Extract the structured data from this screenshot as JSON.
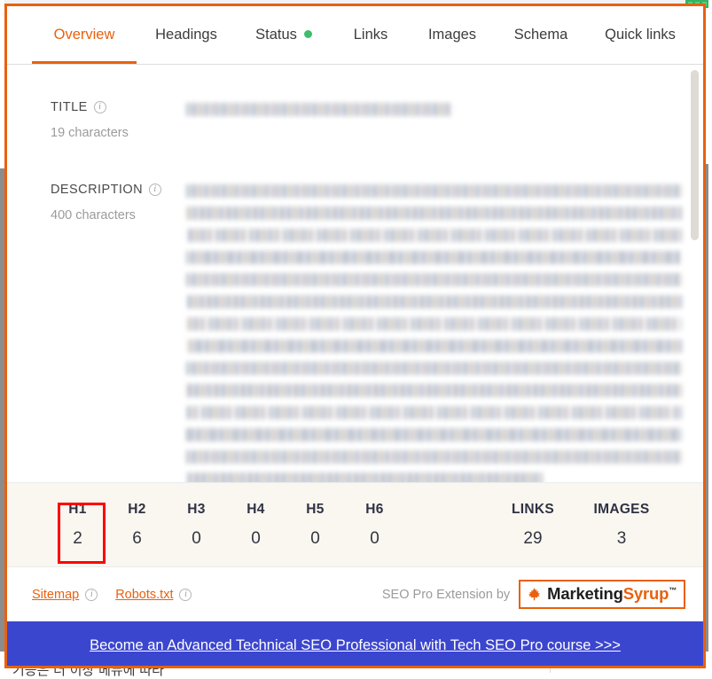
{
  "window": {
    "accent_color": "#e8610f",
    "popup_border_color": "#e8610f",
    "background_page_text": "기능은 더 이상 메뉴에 따라"
  },
  "tabs": [
    {
      "label": "Overview",
      "name": "tab-overview",
      "active": true,
      "dot": false
    },
    {
      "label": "Headings",
      "name": "tab-headings",
      "active": false,
      "dot": false
    },
    {
      "label": "Status",
      "name": "tab-status",
      "active": false,
      "dot": true,
      "dot_color": "#3ebd6f"
    },
    {
      "label": "Links",
      "name": "tab-links",
      "active": false,
      "dot": false
    },
    {
      "label": "Images",
      "name": "tab-images",
      "active": false,
      "dot": false
    },
    {
      "label": "Schema",
      "name": "tab-schema",
      "active": false,
      "dot": false
    },
    {
      "label": "Quick links",
      "name": "tab-quick-links",
      "active": false,
      "dot": false
    }
  ],
  "overview": {
    "title": {
      "label": "TITLE",
      "char_count": "19 characters",
      "value_redacted": true,
      "lines": 1
    },
    "description": {
      "label": "DESCRIPTION",
      "char_count": "400 characters",
      "value_redacted": true,
      "lines": 14
    },
    "info_icon": "ⓘ"
  },
  "stats": {
    "headings": [
      {
        "key": "H1",
        "value": "2",
        "highlighted": true,
        "highlight_color": "#ff0000"
      },
      {
        "key": "H2",
        "value": "6",
        "highlighted": false
      },
      {
        "key": "H3",
        "value": "0",
        "highlighted": false
      },
      {
        "key": "H4",
        "value": "0",
        "highlighted": false
      },
      {
        "key": "H5",
        "value": "0",
        "highlighted": false
      },
      {
        "key": "H6",
        "value": "0",
        "highlighted": false
      }
    ],
    "totals": [
      {
        "key": "LINKS",
        "value": "29"
      },
      {
        "key": "IMAGES",
        "value": "3"
      }
    ]
  },
  "footer": {
    "sitemap_label": "Sitemap",
    "robots_label": "Robots.txt",
    "attribution": "SEO Pro Extension by",
    "brand_part1": "Marketing",
    "brand_part2": "Syrup",
    "brand_tm": "™"
  },
  "promo": {
    "text": "Become an Advanced Technical SEO Professional with Tech SEO Pro course >>>",
    "background": "#3b46cf"
  },
  "scrollbar": {
    "orientation": "vertical",
    "thumb_color": "#dddbd4"
  }
}
